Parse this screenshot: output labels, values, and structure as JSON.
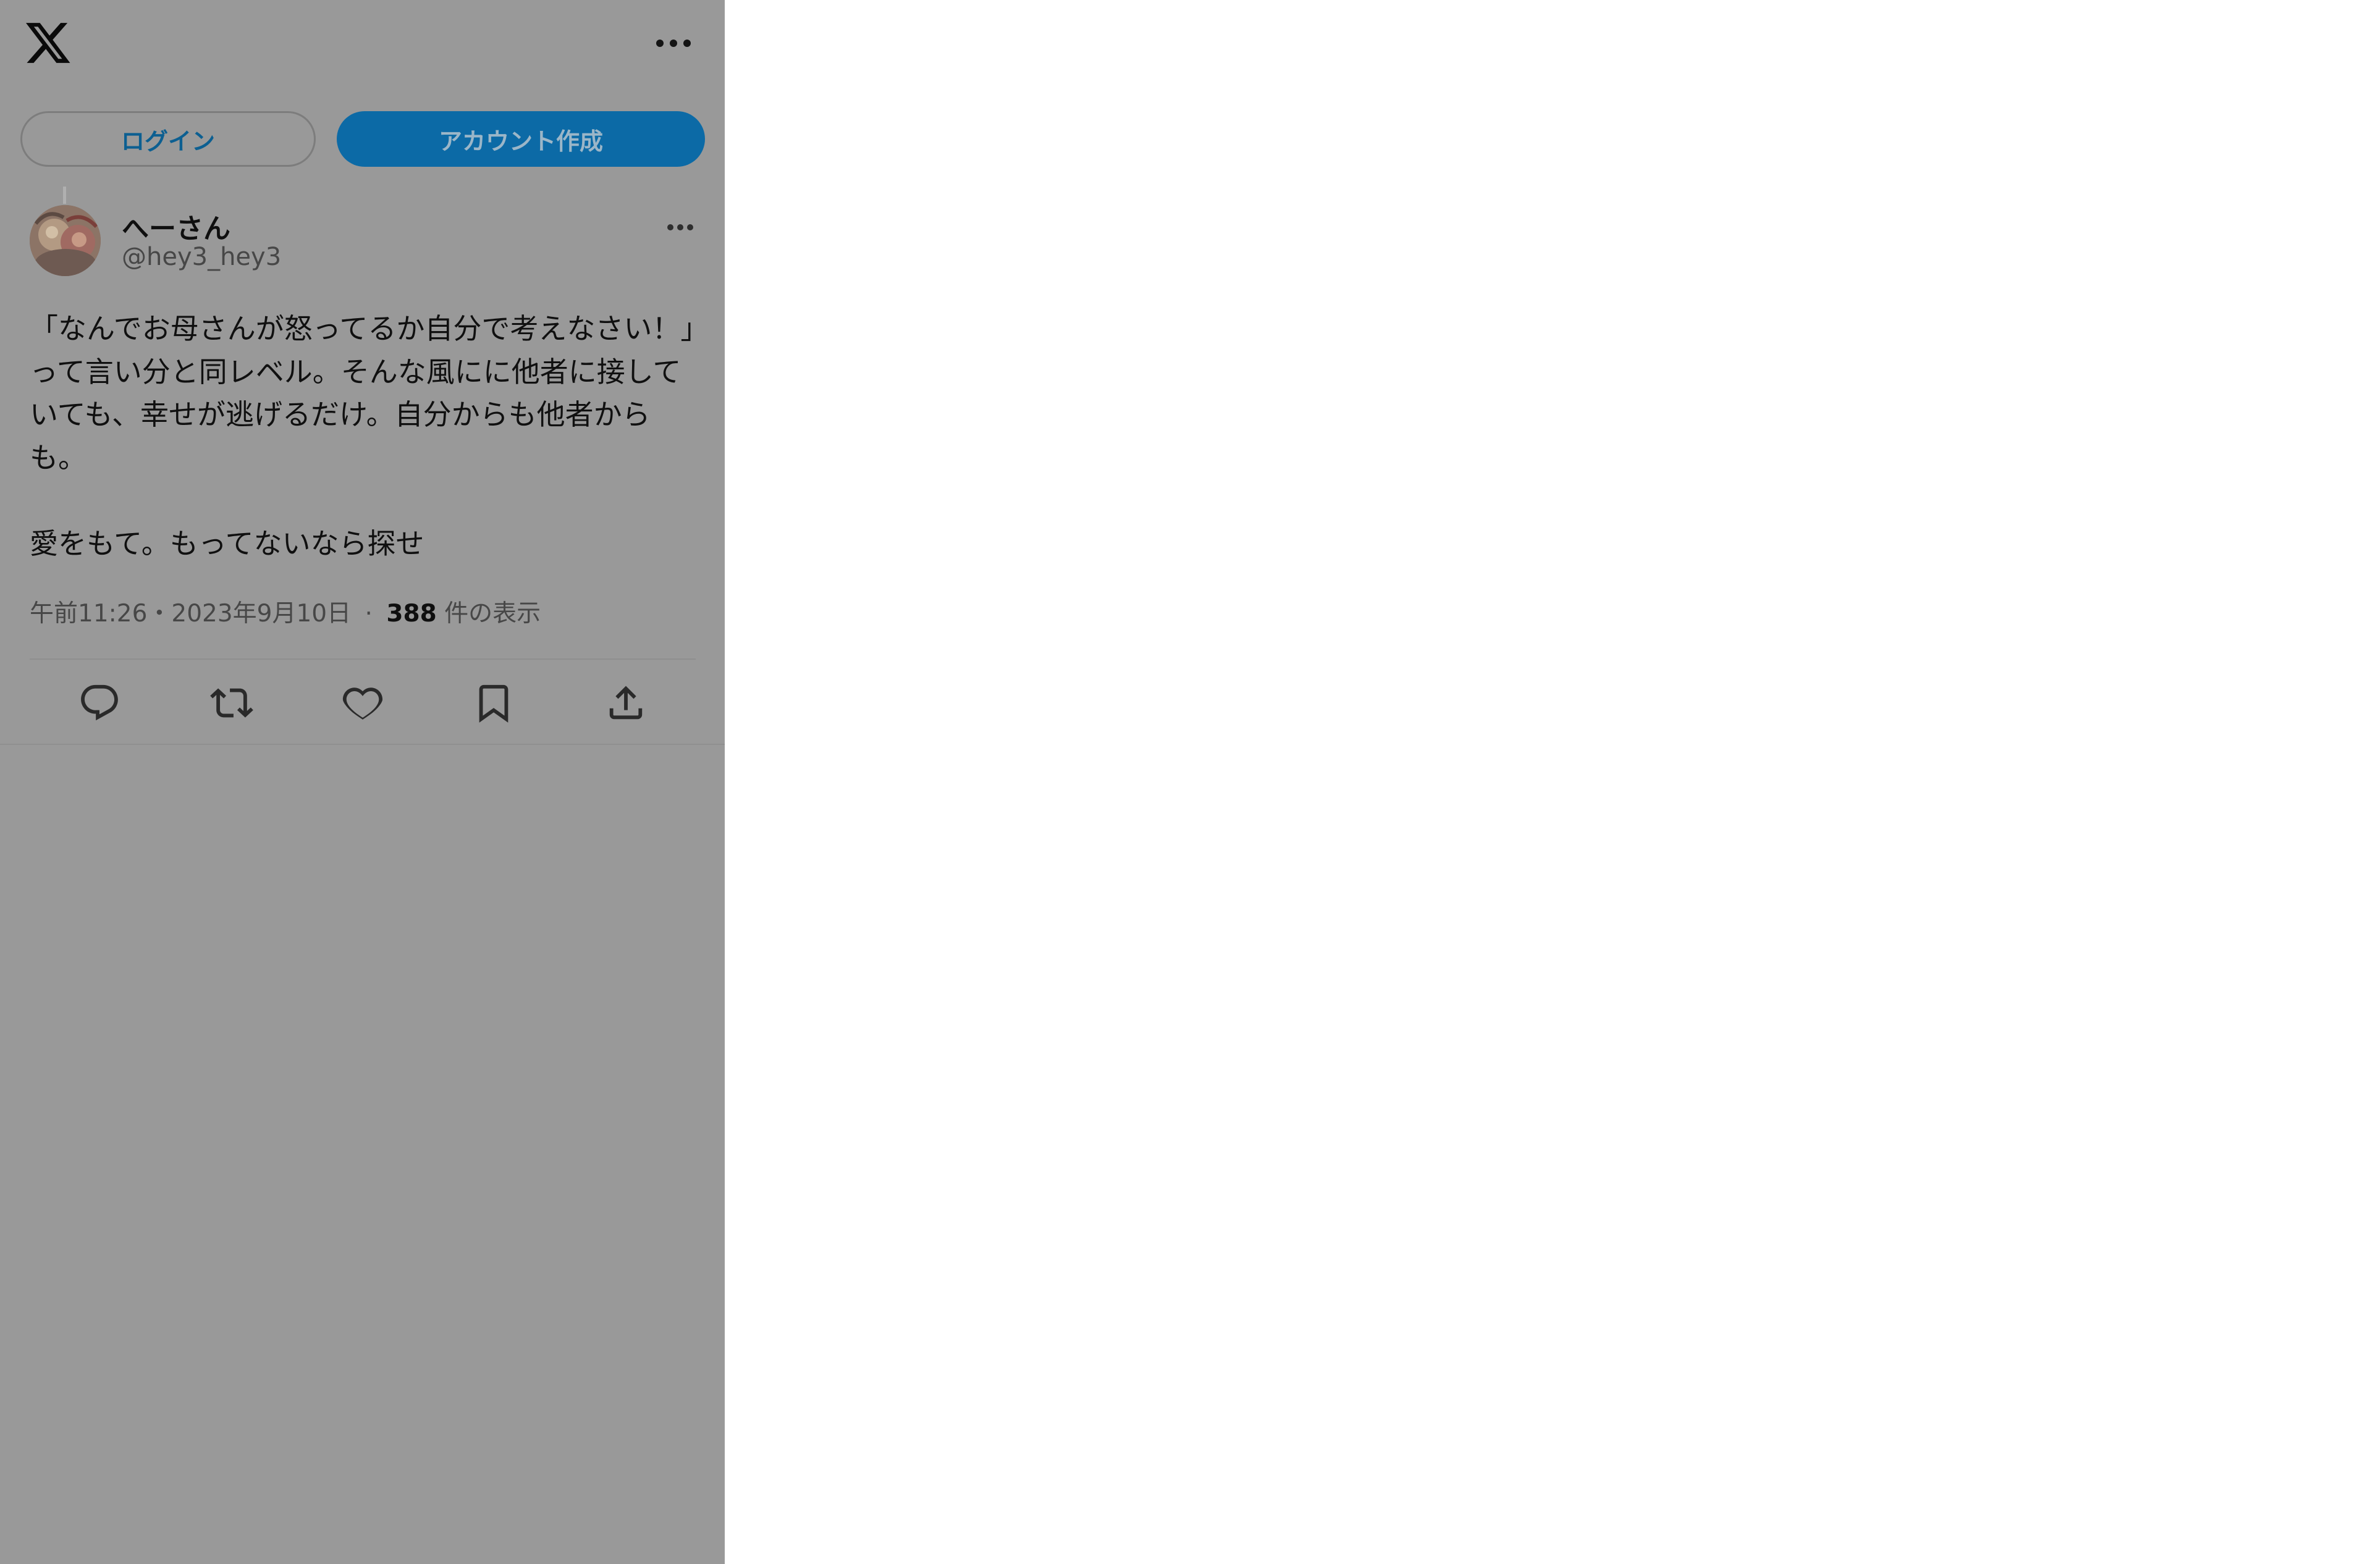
{
  "header": {
    "logo_icon": "x-logo-icon",
    "more_icon": "more-horizontal-icon"
  },
  "auth": {
    "login_label": "ログイン",
    "signup_label": "アカウント作成"
  },
  "tweet": {
    "author_name": "へーさん",
    "author_handle": "@hey3_hey3",
    "text": "「なんでお母さんが怒ってるか自分で考えなさい！」って言い分と同レベル。そんな風にに他者に接していても、幸せが逃げるだけ。自分からも他者からも。\n\n愛をもて。もってないなら探せ",
    "time": "午前11:26",
    "date": "2023年9月10日",
    "separator": "·",
    "views_count": "388",
    "views_label": "件の表示",
    "actions": [
      {
        "icon": "reply-icon"
      },
      {
        "icon": "retweet-icon"
      },
      {
        "icon": "like-icon"
      },
      {
        "icon": "bookmark-icon"
      },
      {
        "icon": "share-icon"
      }
    ]
  },
  "colors": {
    "overlay_bg": "#999999",
    "page_bg": "#ffffff",
    "accent": "#0c6aa6",
    "login_text": "#0c5f91"
  }
}
